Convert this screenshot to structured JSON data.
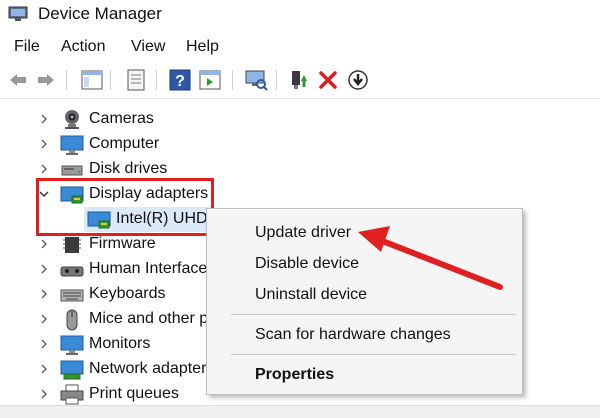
{
  "window": {
    "title": "Device Manager"
  },
  "menu": {
    "file": "File",
    "action": "Action",
    "view": "View",
    "help": "Help"
  },
  "toolbar": {
    "icons": [
      "back-icon",
      "forward-icon",
      "show-hide-tree-icon",
      "properties-icon",
      "help-icon",
      "action-pane-icon",
      "scan-hardware-icon",
      "update-driver-icon",
      "uninstall-icon",
      "disable-icon"
    ]
  },
  "tree": {
    "cameras": "Cameras",
    "computer": "Computer",
    "disk_drives": "Disk drives",
    "display_adapters": "Display adapters",
    "intel": "Intel(R) UHD",
    "firmware": "Firmware",
    "human_interface": "Human Interface",
    "keyboards": "Keyboards",
    "mice": "Mice and other p",
    "monitors": "Monitors",
    "network": "Network adapter",
    "print_queues": "Print queues"
  },
  "context_menu": {
    "update_driver": "Update driver",
    "disable_device": "Disable device",
    "uninstall_device": "Uninstall device",
    "scan": "Scan for hardware changes",
    "properties": "Properties"
  },
  "colors": {
    "highlight": "#e02020",
    "selection": "#dbe9f8",
    "menu_bg": "#f5f5f5"
  }
}
